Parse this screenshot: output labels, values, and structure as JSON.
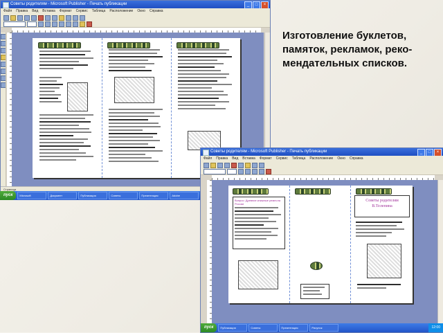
{
  "slide": {
    "title": "Изготовление буклетов,\nпамяток, рекламок, реко-\nмендательных списков."
  },
  "window1": {
    "title": "Советы родителям - Microsoft Publisher - Печать публикации",
    "menu": [
      "Файл",
      "Правка",
      "Вид",
      "Вставка",
      "Формат",
      "Сервис",
      "Таблица",
      "Расположение",
      "Окно",
      "Справка"
    ],
    "status": "Страница"
  },
  "window2": {
    "title": "Советы родителям - Microsoft Publisher - Печать публикации",
    "menu": [
      "Файл",
      "Правка",
      "Вид",
      "Вставка",
      "Формат",
      "Сервис",
      "Таблица",
      "Расположение",
      "Окно",
      "Справка"
    ],
    "brochure_title": "Советы родителям В.Телепина",
    "brochure_left_heading": "Вопрос: Древние книжные ремесла России"
  },
  "taskbar": {
    "start": "пуск",
    "items": [
      "Microsoft",
      "Документ",
      "Публикация",
      "Советы",
      "Презентация",
      "Adobe",
      "Рисунок"
    ],
    "clock": "12:00"
  },
  "colors": {
    "titlebar": "#1f4fc2",
    "canvas": "#7f8ec0",
    "accent_title": "#a0309a"
  }
}
